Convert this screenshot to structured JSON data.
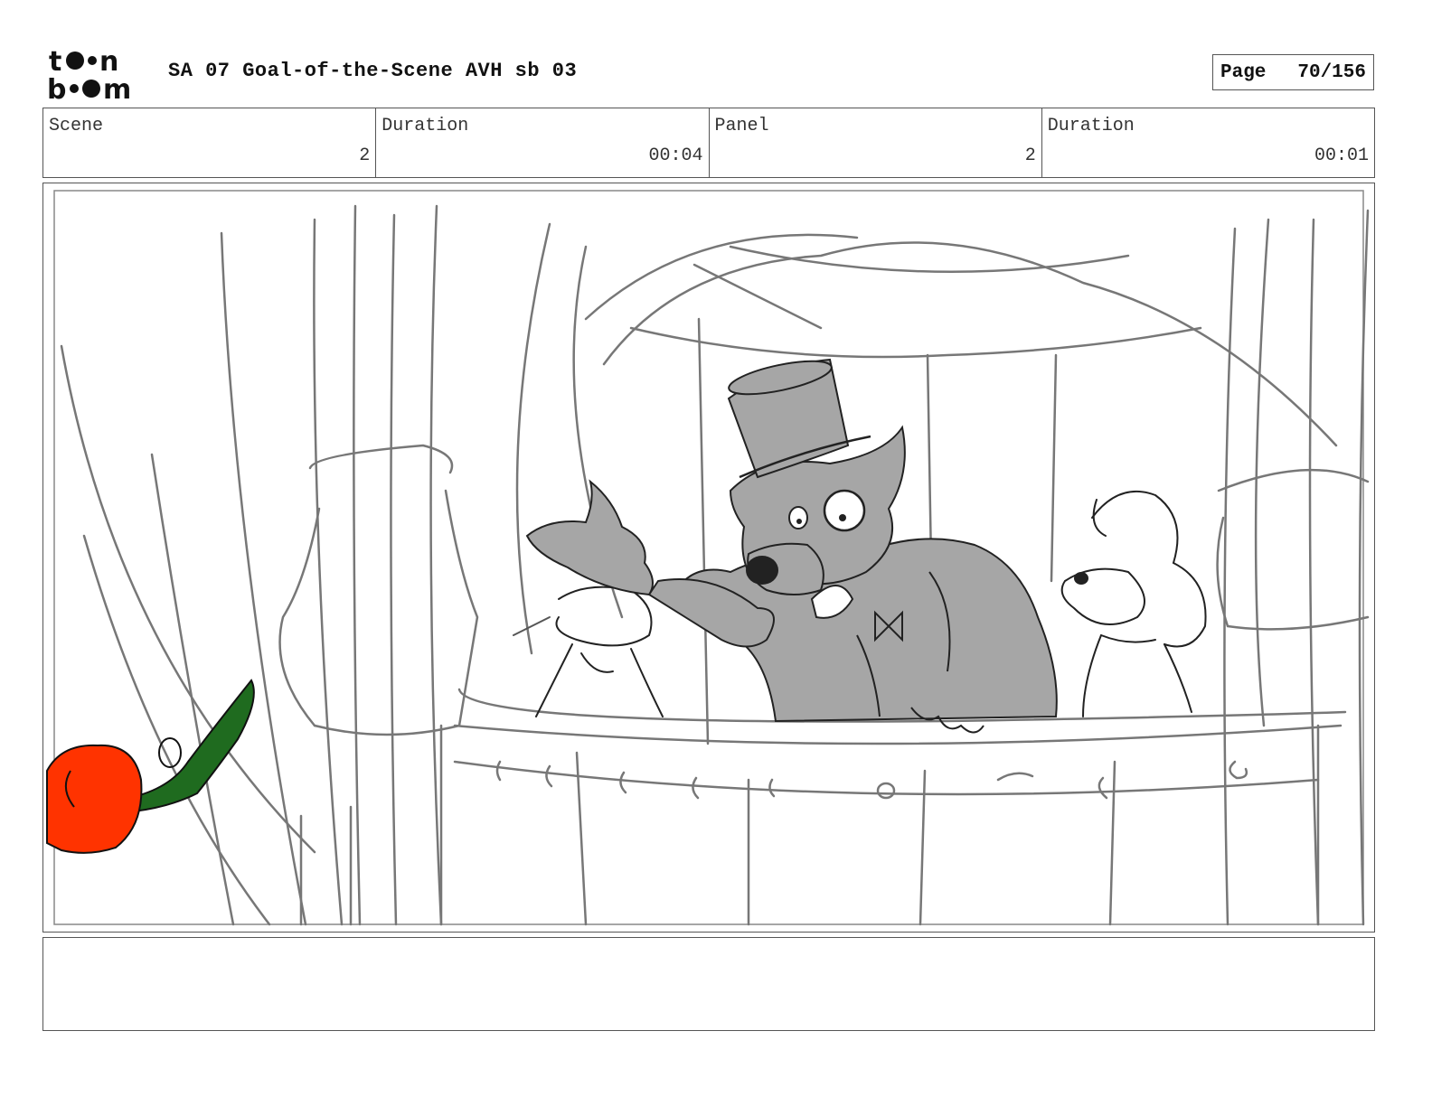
{
  "header": {
    "logo_text": "toon boom",
    "title": "SA 07 Goal-of-the-Scene AVH sb 03",
    "page_label": "Page",
    "page_value": "70/156"
  },
  "info": {
    "scene_label": "Scene",
    "scene_value": "2",
    "scene_duration_label": "Duration",
    "scene_duration_value": "00:04",
    "panel_label": "Panel",
    "panel_value": "2",
    "panel_duration_label": "Duration",
    "panel_duration_value": "00:01"
  },
  "notes": {
    "text": ""
  },
  "colors": {
    "rose": "#ff3300",
    "stem": "#1f6b1f",
    "character_fill": "#a6a6a6",
    "sketch_line": "#777777"
  }
}
